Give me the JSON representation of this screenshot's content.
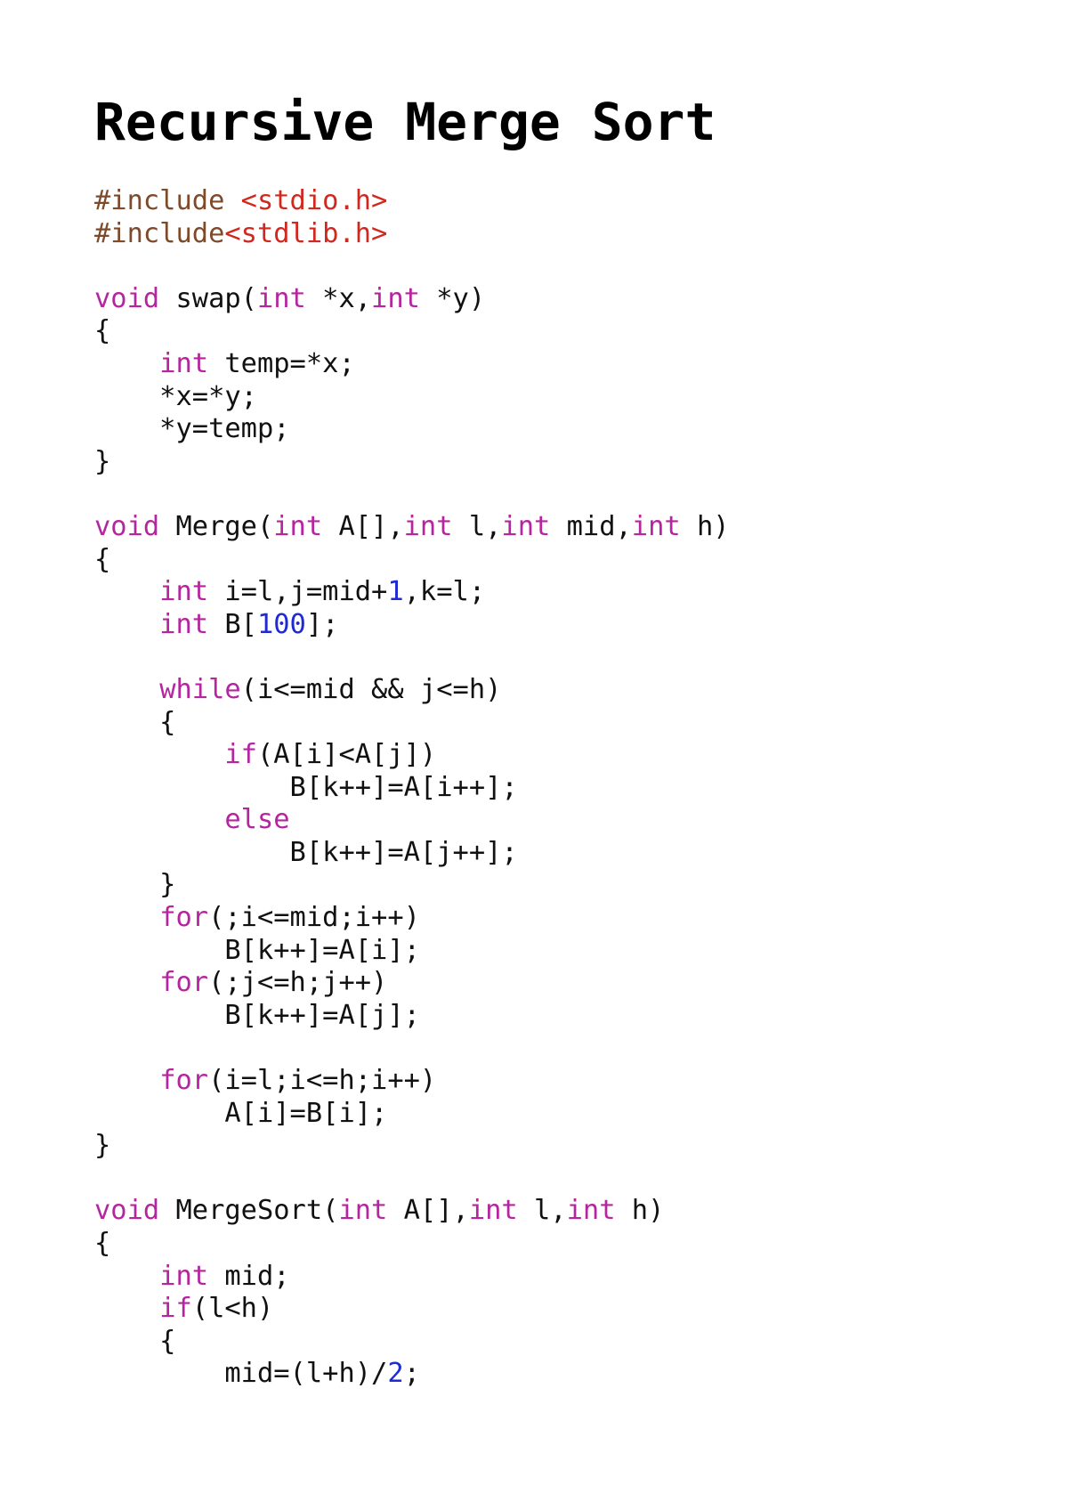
{
  "title": "Recursive Merge Sort",
  "colors": {
    "keyword": "#b5259f",
    "number": "#1f2bd0",
    "preprocessor": "#7d4a2a",
    "header": "#d0281e",
    "text": "#111111"
  },
  "code_lines": [
    [
      [
        "pp",
        "#include "
      ],
      [
        "hdr",
        "<stdio.h>"
      ]
    ],
    [
      [
        "pp",
        "#include"
      ],
      [
        "hdr",
        "<stdlib.h>"
      ]
    ],
    [],
    [
      [
        "kw",
        "void"
      ],
      [
        "pl",
        " swap("
      ],
      [
        "kw",
        "int"
      ],
      [
        "pl",
        " *x,"
      ],
      [
        "kw",
        "int"
      ],
      [
        "pl",
        " *y)"
      ]
    ],
    [
      [
        "pl",
        "{"
      ]
    ],
    [
      [
        "pl",
        "    "
      ],
      [
        "kw",
        "int"
      ],
      [
        "pl",
        " temp=*x;"
      ]
    ],
    [
      [
        "pl",
        "    *x=*y;"
      ]
    ],
    [
      [
        "pl",
        "    *y=temp;"
      ]
    ],
    [
      [
        "pl",
        "}"
      ]
    ],
    [],
    [
      [
        "kw",
        "void"
      ],
      [
        "pl",
        " Merge("
      ],
      [
        "kw",
        "int"
      ],
      [
        "pl",
        " A[],"
      ],
      [
        "kw",
        "int"
      ],
      [
        "pl",
        " l,"
      ],
      [
        "kw",
        "int"
      ],
      [
        "pl",
        " mid,"
      ],
      [
        "kw",
        "int"
      ],
      [
        "pl",
        " h)"
      ]
    ],
    [
      [
        "pl",
        "{"
      ]
    ],
    [
      [
        "pl",
        "    "
      ],
      [
        "kw",
        "int"
      ],
      [
        "pl",
        " i=l,j=mid+"
      ],
      [
        "num",
        "1"
      ],
      [
        "pl",
        ",k=l;"
      ]
    ],
    [
      [
        "pl",
        "    "
      ],
      [
        "kw",
        "int"
      ],
      [
        "pl",
        " B["
      ],
      [
        "num",
        "100"
      ],
      [
        "pl",
        "];"
      ]
    ],
    [],
    [
      [
        "pl",
        "    "
      ],
      [
        "kw",
        "while"
      ],
      [
        "pl",
        "(i<=mid && j<=h)"
      ]
    ],
    [
      [
        "pl",
        "    {"
      ]
    ],
    [
      [
        "pl",
        "        "
      ],
      [
        "kw",
        "if"
      ],
      [
        "pl",
        "(A[i]<A[j])"
      ]
    ],
    [
      [
        "pl",
        "            B[k++]=A[i++];"
      ]
    ],
    [
      [
        "pl",
        "        "
      ],
      [
        "kw",
        "else"
      ]
    ],
    [
      [
        "pl",
        "            B[k++]=A[j++];"
      ]
    ],
    [
      [
        "pl",
        "    }"
      ]
    ],
    [
      [
        "pl",
        "    "
      ],
      [
        "kw",
        "for"
      ],
      [
        "pl",
        "(;i<=mid;i++)"
      ]
    ],
    [
      [
        "pl",
        "        B[k++]=A[i];"
      ]
    ],
    [
      [
        "pl",
        "    "
      ],
      [
        "kw",
        "for"
      ],
      [
        "pl",
        "(;j<=h;j++)"
      ]
    ],
    [
      [
        "pl",
        "        B[k++]=A[j];"
      ]
    ],
    [],
    [
      [
        "pl",
        "    "
      ],
      [
        "kw",
        "for"
      ],
      [
        "pl",
        "(i=l;i<=h;i++)"
      ]
    ],
    [
      [
        "pl",
        "        A[i]=B[i];"
      ]
    ],
    [
      [
        "pl",
        "}"
      ]
    ],
    [],
    [
      [
        "kw",
        "void"
      ],
      [
        "pl",
        " MergeSort("
      ],
      [
        "kw",
        "int"
      ],
      [
        "pl",
        " A[],"
      ],
      [
        "kw",
        "int"
      ],
      [
        "pl",
        " l,"
      ],
      [
        "kw",
        "int"
      ],
      [
        "pl",
        " h)"
      ]
    ],
    [
      [
        "pl",
        "{"
      ]
    ],
    [
      [
        "pl",
        "    "
      ],
      [
        "kw",
        "int"
      ],
      [
        "pl",
        " mid;"
      ]
    ],
    [
      [
        "pl",
        "    "
      ],
      [
        "kw",
        "if"
      ],
      [
        "pl",
        "(l<h)"
      ]
    ],
    [
      [
        "pl",
        "    {"
      ]
    ],
    [
      [
        "pl",
        "        mid=(l+h)/"
      ],
      [
        "num",
        "2"
      ],
      [
        "pl",
        ";"
      ]
    ]
  ]
}
